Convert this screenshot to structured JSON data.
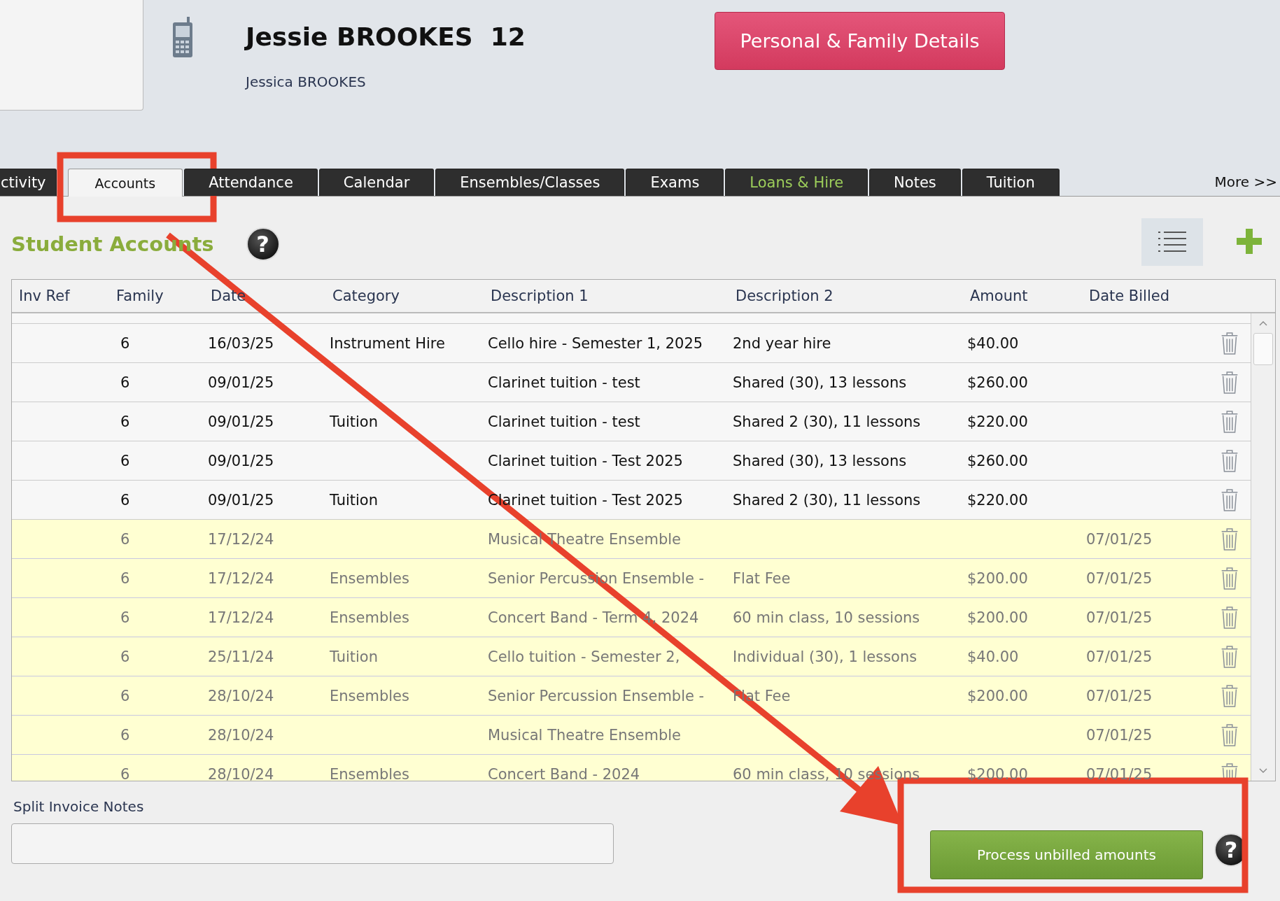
{
  "student": {
    "name": "Jessie BROOKES  12",
    "full_name": "Jessica BROOKES"
  },
  "details_button": "Personal & Family Details",
  "tabs": [
    {
      "label": "ctivity",
      "selected": false,
      "highlighted": false
    },
    {
      "label": "Accounts",
      "selected": true,
      "highlighted": false
    },
    {
      "label": "Attendance",
      "selected": false,
      "highlighted": false
    },
    {
      "label": "Calendar",
      "selected": false,
      "highlighted": false
    },
    {
      "label": "Ensembles/Classes",
      "selected": false,
      "highlighted": false
    },
    {
      "label": "Exams",
      "selected": false,
      "highlighted": false
    },
    {
      "label": "Loans & Hire",
      "selected": false,
      "highlighted": true
    },
    {
      "label": "Notes",
      "selected": false,
      "highlighted": false
    },
    {
      "label": "Tuition",
      "selected": false,
      "highlighted": false
    }
  ],
  "more_link": "More >>",
  "section_title": "Student Accounts",
  "help_glyph": "?",
  "table": {
    "columns": [
      "Inv Ref",
      "Family",
      "Date",
      "Category",
      "Description 1",
      "Description 2",
      "Amount",
      "Date Billed"
    ],
    "rows": [
      {
        "family": "6",
        "date": "16/03/25",
        "category": "Instrument Hire",
        "description_1": "Cello hire - Semester 1, 2025",
        "description_2": "2nd year hire",
        "amount": "$40.00",
        "date_billed": "",
        "billed": false
      },
      {
        "family": "6",
        "date": "09/01/25",
        "category": "",
        "description_1": "Clarinet tuition - test",
        "description_2": "Shared (30), 13 lessons",
        "amount": "$260.00",
        "date_billed": "",
        "billed": false
      },
      {
        "family": "6",
        "date": "09/01/25",
        "category": "Tuition",
        "description_1": "Clarinet tuition - test",
        "description_2": "Shared 2 (30), 11 lessons",
        "amount": "$220.00",
        "date_billed": "",
        "billed": false
      },
      {
        "family": "6",
        "date": "09/01/25",
        "category": "",
        "description_1": "Clarinet tuition - Test 2025",
        "description_2": "Shared (30), 13 lessons",
        "amount": "$260.00",
        "date_billed": "",
        "billed": false
      },
      {
        "family": "6",
        "date": "09/01/25",
        "category": "Tuition",
        "description_1": "Clarinet tuition - Test 2025",
        "description_2": "Shared 2 (30), 11 lessons",
        "amount": "$220.00",
        "date_billed": "",
        "billed": false
      },
      {
        "family": "6",
        "date": "17/12/24",
        "category": "",
        "description_1": "Musical Theatre Ensemble",
        "description_2": "",
        "amount": "",
        "date_billed": "07/01/25",
        "billed": true
      },
      {
        "family": "6",
        "date": "17/12/24",
        "category": "Ensembles",
        "description_1": "Senior Percussion Ensemble -",
        "description_2": "Flat Fee",
        "amount": "$200.00",
        "date_billed": "07/01/25",
        "billed": true
      },
      {
        "family": "6",
        "date": "17/12/24",
        "category": "Ensembles",
        "description_1": "Concert Band - Term 4, 2024",
        "description_2": "60 min class, 10 sessions",
        "amount": "$200.00",
        "date_billed": "07/01/25",
        "billed": true
      },
      {
        "family": "6",
        "date": "25/11/24",
        "category": "Tuition",
        "description_1": "Cello tuition - Semester 2,",
        "description_2": "Individual (30), 1 lessons",
        "amount": "$40.00",
        "date_billed": "07/01/25",
        "billed": true
      },
      {
        "family": "6",
        "date": "28/10/24",
        "category": "Ensembles",
        "description_1": "Senior Percussion Ensemble -",
        "description_2": "Flat Fee",
        "amount": "$200.00",
        "date_billed": "07/01/25",
        "billed": true
      },
      {
        "family": "6",
        "date": "28/10/24",
        "category": "",
        "description_1": "Musical Theatre Ensemble",
        "description_2": "",
        "amount": "",
        "date_billed": "07/01/25",
        "billed": true
      },
      {
        "family": "6",
        "date": "28/10/24",
        "category": "Ensembles",
        "description_1": "Concert Band - 2024",
        "description_2": "60 min class, 10 sessions",
        "amount": "$200.00",
        "date_billed": "07/01/25",
        "billed": true
      }
    ]
  },
  "notes_label": "Split Invoice Notes",
  "process_button": "Process unbilled amounts"
}
